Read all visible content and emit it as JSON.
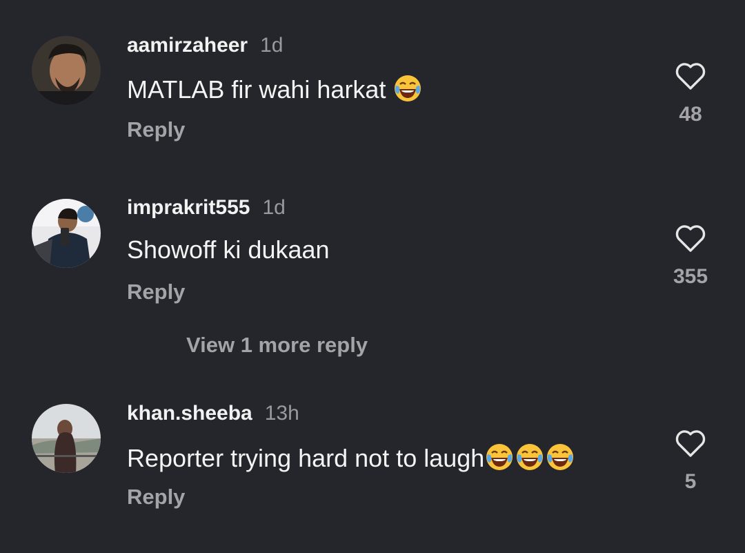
{
  "comments": [
    {
      "username": "aamirzaheer",
      "time": "1d",
      "text": "MATLAB fir wahi harkat",
      "emojis": [
        "face-with-tears-of-joy"
      ],
      "reply_label": "Reply",
      "likes": "48"
    },
    {
      "username": "imprakrit555",
      "time": "1d",
      "text": "Showoff ki dukaan",
      "emojis": [],
      "reply_label": "Reply",
      "likes": "355",
      "view_more_label": "View 1 more reply"
    },
    {
      "username": "khan.sheeba",
      "time": "13h",
      "text": "Reporter trying hard not to laugh",
      "emojis": [
        "face-with-tears-of-joy",
        "face-with-tears-of-joy",
        "face-with-tears-of-joy"
      ],
      "reply_label": "Reply",
      "likes": "5"
    }
  ],
  "colors": {
    "background": "#25262b",
    "primary_text": "#f2f2f2",
    "secondary_text": "#a3a3a8"
  },
  "icons": {
    "like": "heart-outline-icon",
    "emoji": "face-with-tears-of-joy-emoji"
  }
}
